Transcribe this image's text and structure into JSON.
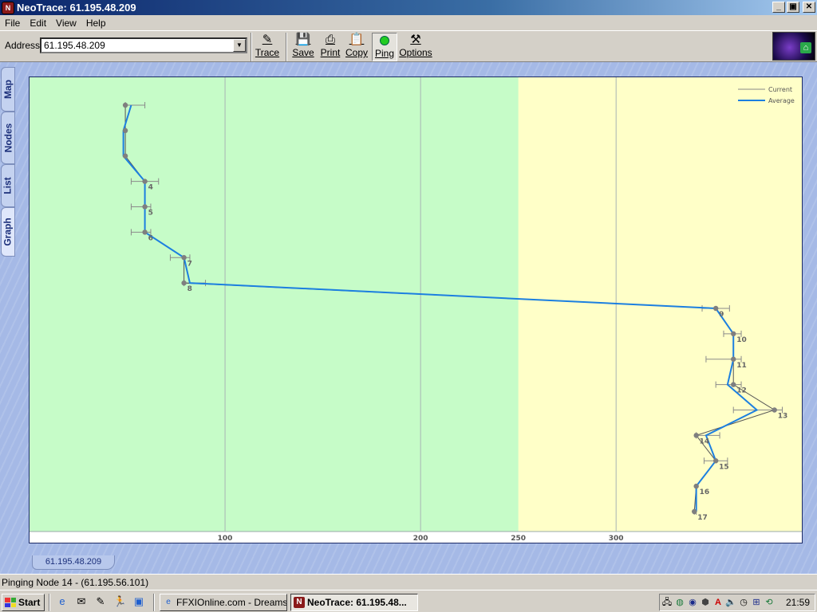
{
  "window": {
    "title": "NeoTrace: 61.195.48.209",
    "controls": {
      "minimize": "_",
      "restore": "▣",
      "close": "✕"
    }
  },
  "menu": [
    "File",
    "Edit",
    "View",
    "Help"
  ],
  "toolbar": {
    "address_label": "Address",
    "address_value": "61.195.48.209",
    "buttons": [
      {
        "label": "Trace",
        "icon": "trace-icon"
      },
      {
        "label": "Save",
        "icon": "floppy-disk-icon"
      },
      {
        "label": "Print",
        "icon": "printer-icon"
      },
      {
        "label": "Copy",
        "icon": "clipboard-icon"
      },
      {
        "label": "Ping",
        "icon": "green-light-icon"
      },
      {
        "label": "Options",
        "icon": "tools-icon"
      }
    ]
  },
  "side_tabs": [
    "Map",
    "Nodes",
    "List",
    "Graph"
  ],
  "bottom_tab": "61.195.48.209",
  "status": "Pinging Node 14 - (61.195.56.101)",
  "colors": {
    "good_zone": "#c6fcc8",
    "warn_zone": "#ffffc8",
    "average_line": "#1c7fe0",
    "current_line": "#555555",
    "node_marker": "#7f7f7f"
  },
  "chart_data": {
    "type": "line",
    "orientation": "horizontal",
    "x_ticks": [
      100,
      200,
      250,
      300
    ],
    "xlim": [
      0,
      395
    ],
    "zones": [
      {
        "from": 0,
        "to": 250,
        "color": "#c6fcc8"
      },
      {
        "from": 250,
        "to": 395,
        "color": "#ffffc8"
      }
    ],
    "legend": {
      "position": "top-right",
      "entries": [
        "Current",
        "Average"
      ]
    },
    "nodes": [
      {
        "hop": 1,
        "label": "",
        "current": 49,
        "average": 52,
        "err": [
          49,
          59
        ]
      },
      {
        "hop": 2,
        "label": "",
        "current": 49,
        "average": 48,
        "err": [
          49,
          49
        ]
      },
      {
        "hop": 3,
        "label": "",
        "current": 49,
        "average": 48,
        "err": [
          49,
          49
        ]
      },
      {
        "hop": 4,
        "label": "4",
        "current": 59,
        "average": 59,
        "err": [
          52,
          66
        ]
      },
      {
        "hop": 5,
        "label": "5",
        "current": 59,
        "average": 59,
        "err": [
          52,
          62
        ]
      },
      {
        "hop": 6,
        "label": "6",
        "current": 59,
        "average": 59,
        "err": [
          52,
          62
        ]
      },
      {
        "hop": 7,
        "label": "7",
        "current": 79,
        "average": 79,
        "err": [
          72,
          82
        ]
      },
      {
        "hop": 8,
        "label": "8",
        "current": 79,
        "average": 82,
        "err": [
          79,
          90
        ]
      },
      {
        "hop": 9,
        "label": "9",
        "current": 351,
        "average": 351,
        "err": [
          344,
          358
        ]
      },
      {
        "hop": 10,
        "label": "10",
        "current": 360,
        "average": 360,
        "err": [
          355,
          364
        ]
      },
      {
        "hop": 11,
        "label": "11",
        "current": 360,
        "average": 360,
        "err": [
          346,
          364
        ]
      },
      {
        "hop": 12,
        "label": "12",
        "current": 360,
        "average": 357,
        "err": [
          351,
          364
        ]
      },
      {
        "hop": 13,
        "label": "13",
        "current": 381,
        "average": 372,
        "err": [
          360,
          385
        ]
      },
      {
        "hop": 14,
        "label": "14",
        "current": 341,
        "average": 346,
        "err": [
          341,
          353
        ]
      },
      {
        "hop": 15,
        "label": "15",
        "current": 351,
        "average": 351,
        "err": [
          345,
          357
        ]
      },
      {
        "hop": 16,
        "label": "16",
        "current": 341,
        "average": 341,
        "err": [
          341,
          341
        ]
      },
      {
        "hop": 17,
        "label": "17",
        "current": 340,
        "average": 341,
        "err": [
          340,
          341
        ]
      }
    ]
  },
  "taskbar": {
    "start": "Start",
    "quicklaunch": [
      "ie-icon",
      "outlook-icon",
      "notepad-icon",
      "aim-icon",
      "desktop-icon"
    ],
    "tasks": [
      {
        "label": "FFXIOnline.com - Dreams i...",
        "icon": "ie-icon",
        "active": false
      },
      {
        "label": "NeoTrace: 61.195.48...",
        "icon": "neotrace-icon",
        "active": true
      }
    ],
    "tray_icons": [
      "network-icon",
      "globe-icon",
      "media-icon",
      "shield-icon",
      "ati-icon",
      "speaker-icon",
      "clock-icon",
      "language-icon",
      "sync-icon"
    ],
    "clock": "21:59"
  }
}
